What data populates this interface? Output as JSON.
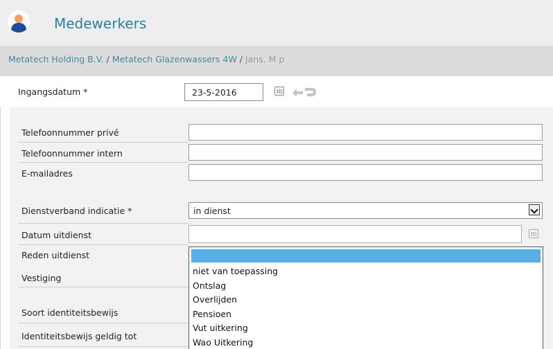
{
  "header": {
    "title": "Medewerkers",
    "title_color": "#2a7ea0"
  },
  "breadcrumb": {
    "items": [
      "Metatech Holding B.V.",
      "Metatech Glazenwassers 4W"
    ],
    "separator": " / ",
    "current": "Jans, M p"
  },
  "ingangsdatum": {
    "label": "Ingangsdatum *",
    "value": "23-5-2016"
  },
  "fields": {
    "telefoon_prive": {
      "label": "Telefoonnummer privé",
      "value": ""
    },
    "telefoon_intern": {
      "label": "Telefoonnummer intern",
      "value": ""
    },
    "email": {
      "label": "E-mailadres",
      "value": ""
    },
    "dienstverband": {
      "label": "Dienstverband indicatie *",
      "value": "in dienst"
    },
    "datum_uitdienst": {
      "label": "Datum uitdienst",
      "value": ""
    },
    "reden_uitdienst": {
      "label": "Reden uitdienst"
    },
    "vestiging": {
      "label": "Vestiging"
    },
    "soort_id": {
      "label": "Soort identiteitsbewijs"
    },
    "id_geldig_tot": {
      "label": "Identiteitsbewijs geldig tot"
    }
  },
  "reden_dropdown": {
    "selected_index": 0,
    "options": [
      "",
      "niet van toepassing",
      "Ontslag",
      "Overlijden",
      "Pensioen",
      "Vut uitkering",
      "Wao Uitkering"
    ]
  },
  "icons": {
    "avatar": "user-avatar-icon",
    "calendar": "calendar-icon",
    "swap": "undo-redo-icon",
    "dropdown": "chevron-down-icon"
  },
  "colors": {
    "accent": "#2a7ea0",
    "selection": "#56b0e4"
  }
}
